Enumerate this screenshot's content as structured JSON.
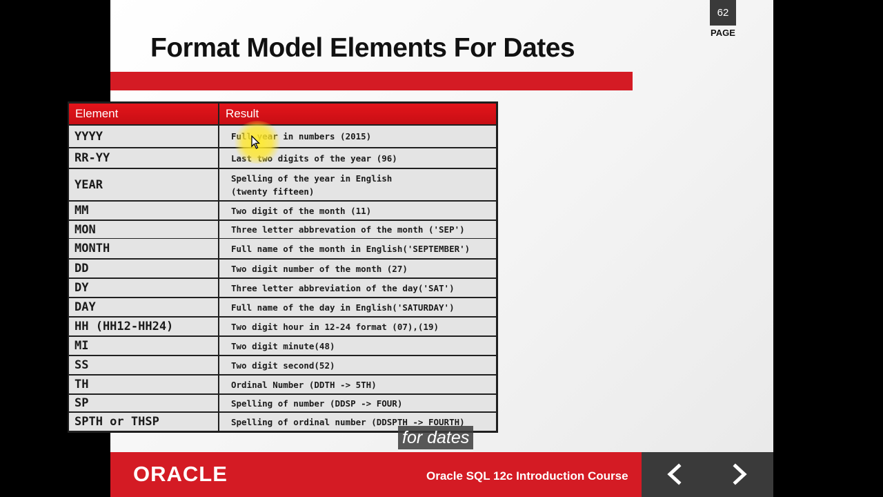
{
  "slide": {
    "title": "Format Model Elements For Dates",
    "page_number": "62",
    "page_label": "PAGE"
  },
  "table": {
    "headers": {
      "element": "Element",
      "result": "Result"
    },
    "rows": [
      {
        "element": "YYYY",
        "result": "Full year in numbers (2015)"
      },
      {
        "element": "RR-YY",
        "result": "Last two digits of the year (96)"
      },
      {
        "element": "YEAR",
        "result": "Spelling of the year in English\n(twenty fifteen)"
      },
      {
        "element": "MM",
        "result": "Two digit of the month (11)"
      },
      {
        "element": "MON",
        "result": "Three letter abbrevation of the month ('SEP')"
      },
      {
        "element": "MONTH",
        "result": "Full name of the month in English('SEPTEMBER')"
      },
      {
        "element": "DD",
        "result": "Two digit number of the month (27)"
      },
      {
        "element": "DY",
        "result": "Three letter abbreviation of the day('SAT')"
      },
      {
        "element": "DAY",
        "result": "Full name of the day in English('SATURDAY')"
      },
      {
        "element": "HH (HH12-HH24)",
        "result": "Two digit hour in 12-24 format (07),(19)"
      },
      {
        "element": "MI",
        "result": "Two digit minute(48)"
      },
      {
        "element": "SS",
        "result": "Two digit second(52)"
      },
      {
        "element": "TH",
        "result": "Ordinal Number (DDTH -> 5TH)"
      },
      {
        "element": "SP",
        "result": "Spelling of number (DDSP -> FOUR)"
      },
      {
        "element": "SPTH or THSP",
        "result": "Spelling of ordinal number (DDSPTH -> FOURTH)"
      }
    ]
  },
  "subtitle": "for dates",
  "footer": {
    "logo": "ORACLE",
    "course": "Oracle SQL 12c Introduction Course"
  },
  "icons": {
    "prev": "chevron-left-icon",
    "next": "chevron-right-icon",
    "cursor": "mouse-cursor-icon"
  },
  "colors": {
    "accent": "#d41b24",
    "nav_bg": "#3a3a3a",
    "header_red": "#e3141b",
    "cell_bg": "#e4e4e4"
  }
}
